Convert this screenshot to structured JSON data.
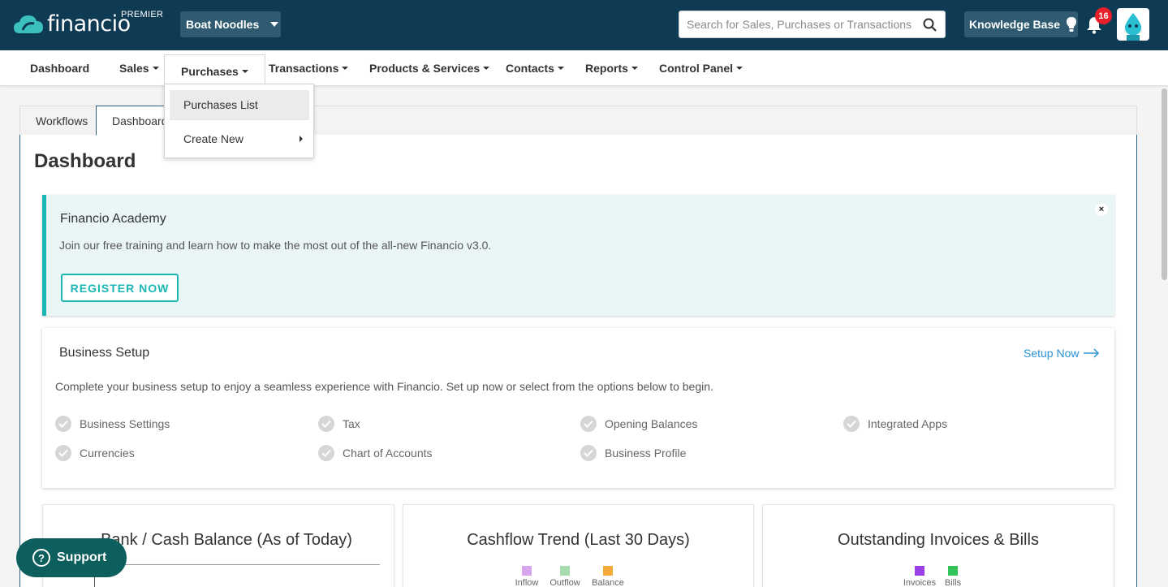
{
  "header": {
    "logo_text": "financio",
    "plan": "PREMIER",
    "company": "Boat Noodles",
    "search_placeholder": "Search for Sales, Purchases or Transactions",
    "knowledge_base": "Knowledge Base",
    "notification_count": "16"
  },
  "nav": {
    "items": [
      {
        "label": "Dashboard"
      },
      {
        "label": "Sales"
      },
      {
        "label": "Purchases"
      },
      {
        "label": "Transactions"
      },
      {
        "label": "Products & Services"
      },
      {
        "label": "Contacts"
      },
      {
        "label": "Reports"
      },
      {
        "label": "Control Panel"
      }
    ],
    "purchases_menu": [
      {
        "label": "Purchases List"
      },
      {
        "label": "Create New"
      }
    ]
  },
  "tabs": [
    {
      "label": "Workflows"
    },
    {
      "label": "Dashboard"
    }
  ],
  "page_title": "Dashboard",
  "academy": {
    "title": "Financio Academy",
    "description": "Join our free training and learn how to make the most out of the all-new Financio v3.0.",
    "button": "REGISTER NOW",
    "close": "×"
  },
  "setup": {
    "title": "Business Setup",
    "link": "Setup Now",
    "description": "Complete your business setup to enjoy a seamless experience with Financio. Set up now or select from the options below to begin.",
    "items": [
      {
        "label": "Business Settings"
      },
      {
        "label": "Tax"
      },
      {
        "label": "Opening Balances"
      },
      {
        "label": "Integrated Apps"
      },
      {
        "label": "Currencies"
      },
      {
        "label": "Chart of Accounts"
      },
      {
        "label": "Business Profile"
      }
    ]
  },
  "cards": [
    {
      "title": "Bank / Cash Balance (As of Today)"
    },
    {
      "title": "Cashflow Trend (Last 30 Days)",
      "legend": [
        {
          "label": "Inflow",
          "color": "#d9a5f0"
        },
        {
          "label": "Outflow",
          "color": "#a6ddb0"
        },
        {
          "label": "Balance",
          "color": "#f5a93b"
        }
      ]
    },
    {
      "title": "Outstanding Invoices & Bills",
      "legend": [
        {
          "label": "Invoices",
          "color": "#9b3fe6"
        },
        {
          "label": "Bills",
          "color": "#34c35a"
        }
      ]
    }
  ],
  "support": {
    "label": "Support"
  },
  "colors": {
    "topbar": "#0e3a53",
    "accent": "#1bb7b5",
    "link": "#2a93d5"
  }
}
